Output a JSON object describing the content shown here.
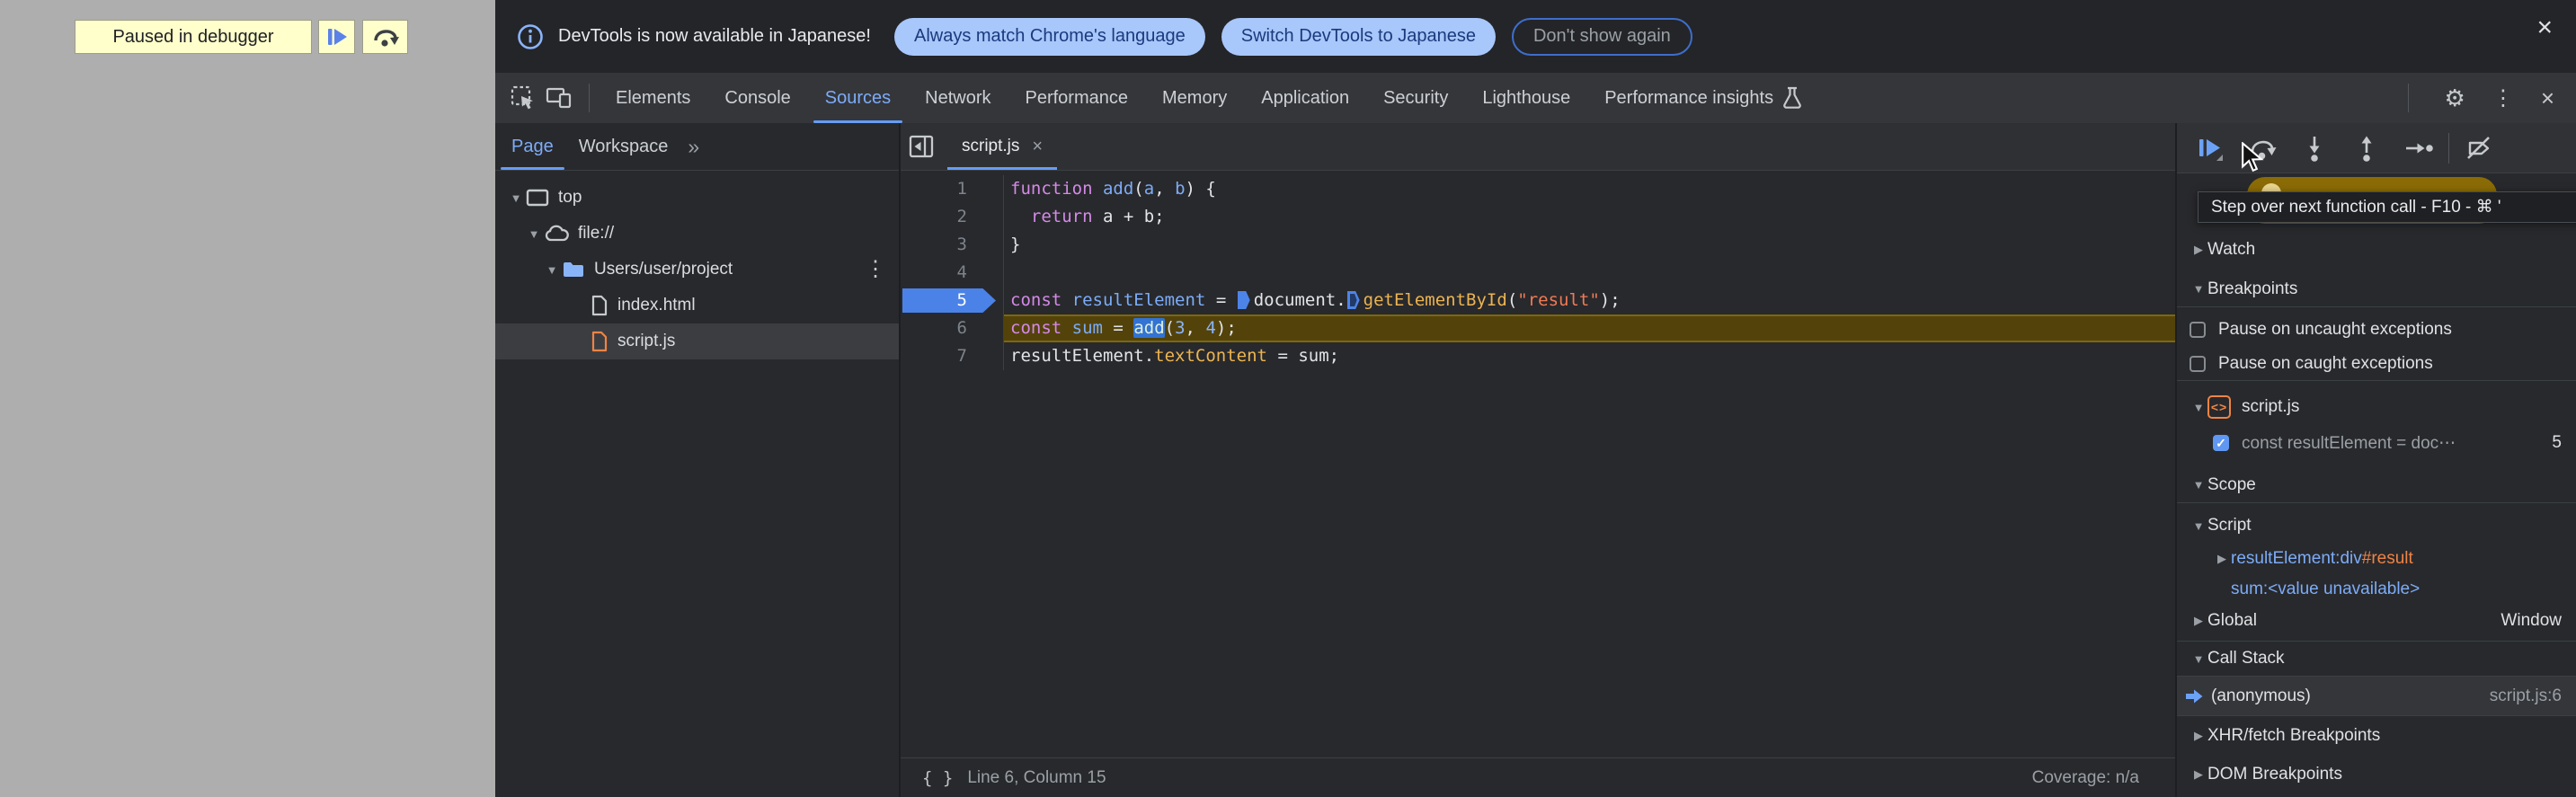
{
  "palette": {
    "accent_blue": "#7cacf8",
    "breakpoint_blue": "#4a82e8",
    "paused_line_gold": "#53430b",
    "string_orange": "#f07a56",
    "keyword_purple": "#d48ae8",
    "property_yellow": "#ecb452",
    "warning_yellow": "#ffffcc",
    "panel_dark": "#28292c"
  },
  "page": {
    "paused_banner": {
      "label": "Paused in debugger"
    }
  },
  "banner": {
    "message": "DevTools is now available in Japanese!",
    "primary_button": "Always match Chrome's language",
    "secondary_button": "Switch DevTools to Japanese",
    "dismiss_button": "Don't show again",
    "close": "×"
  },
  "tabs": {
    "items": [
      {
        "slug": "elements",
        "label": "Elements",
        "selected": false
      },
      {
        "slug": "console",
        "label": "Console",
        "selected": false
      },
      {
        "slug": "sources",
        "label": "Sources",
        "selected": true
      },
      {
        "slug": "network",
        "label": "Network",
        "selected": false
      },
      {
        "slug": "performance",
        "label": "Performance",
        "selected": false
      },
      {
        "slug": "memory",
        "label": "Memory",
        "selected": false
      },
      {
        "slug": "application",
        "label": "Application",
        "selected": false
      },
      {
        "slug": "security",
        "label": "Security",
        "selected": false
      },
      {
        "slug": "lighthouse",
        "label": "Lighthouse",
        "selected": false
      },
      {
        "slug": "performance-insights",
        "label": "Performance insights",
        "selected": false,
        "icon": "flask"
      }
    ],
    "right_icons": {
      "settings": "⚙",
      "more": "⋮",
      "close": "×"
    }
  },
  "navigator": {
    "page_tab": "Page",
    "workspace_tab": "Workspace",
    "more_tabs": "»",
    "menu": "⋮",
    "tree": [
      {
        "label": "top"
      },
      {
        "label": "file://"
      },
      {
        "label": "Users/user/project"
      },
      {
        "label": "index.html"
      },
      {
        "label": "script.js",
        "selected": true
      }
    ]
  },
  "editor": {
    "file_tab": "script.js",
    "file_tab_close": "×",
    "lines": [
      {
        "num": "1",
        "tokens": [
          {
            "c": "kw",
            "t": "function"
          },
          {
            "c": "pl",
            "t": " "
          },
          {
            "c": "vr",
            "t": "add"
          },
          {
            "c": "pl",
            "t": "("
          },
          {
            "c": "vr",
            "t": "a"
          },
          {
            "c": "pl",
            "t": ", "
          },
          {
            "c": "vr",
            "t": "b"
          },
          {
            "c": "pl",
            "t": ") {"
          }
        ]
      },
      {
        "num": "2",
        "tokens": [
          {
            "c": "pl",
            "t": "  "
          },
          {
            "c": "kw",
            "t": "return"
          },
          {
            "c": "pl",
            "t": " a + b;"
          }
        ]
      },
      {
        "num": "3",
        "tokens": [
          {
            "c": "pl",
            "t": "}"
          }
        ]
      },
      {
        "num": "4",
        "tokens": []
      },
      {
        "num": "5",
        "bp": true,
        "tokens": [
          {
            "c": "kw",
            "t": "const"
          },
          {
            "c": "pl",
            "t": " "
          },
          {
            "c": "vr",
            "t": "resultElement"
          },
          {
            "c": "pl",
            "t": " = "
          },
          {
            "c": "mk"
          },
          {
            "c": "pl",
            "t": "document."
          },
          {
            "c": "mko"
          },
          {
            "c": "fn",
            "t": "getElementById"
          },
          {
            "c": "pl",
            "t": "("
          },
          {
            "c": "str",
            "t": "\"result\""
          },
          {
            "c": "pl",
            "t": ");"
          }
        ]
      },
      {
        "num": "6",
        "paused": true,
        "tokens": [
          {
            "c": "kw",
            "t": "const"
          },
          {
            "c": "pl",
            "t": " "
          },
          {
            "c": "vr",
            "t": "sum"
          },
          {
            "c": "pl",
            "t": " = "
          },
          {
            "c": "sel",
            "t": "add"
          },
          {
            "c": "pl",
            "t": "("
          },
          {
            "c": "num2",
            "t": "3"
          },
          {
            "c": "pl",
            "t": ", "
          },
          {
            "c": "num2",
            "t": "4"
          },
          {
            "c": "pl",
            "t": ");"
          }
        ]
      },
      {
        "num": "7",
        "tokens": [
          {
            "c": "pl",
            "t": "resultElement."
          },
          {
            "c": "fn",
            "t": "textContent"
          },
          {
            "c": "pl",
            "t": " = sum;"
          }
        ]
      }
    ],
    "status": {
      "braces": "{ }",
      "position": "Line 6, Column 15",
      "coverage": "Coverage: n/a"
    }
  },
  "debugger": {
    "tooltip": "Step over next function call - F10 - ⌘ '",
    "watch": "Watch",
    "breakpoints": "Breakpoints",
    "pause_uncaught": "Pause on uncaught exceptions",
    "pause_caught": "Pause on caught exceptions",
    "bp_group": {
      "file": "script.js",
      "entry_text": "const resultElement = doc⋯",
      "entry_line": "5",
      "check": "✓"
    },
    "scope": "Scope",
    "scope_script": "Script",
    "var_result": {
      "name": "resultElement",
      "sep": ": ",
      "tag": "div",
      "id": "#result"
    },
    "var_sum": {
      "name": "sum",
      "sep": ": ",
      "value": "<value unavailable>"
    },
    "global": {
      "label": "Global",
      "value": "Window"
    },
    "call_stack": "Call Stack",
    "frame": {
      "name": "(anonymous)",
      "location": "script.js:6"
    },
    "xhr": "XHR/fetch Breakpoints",
    "dom": "DOM Breakpoints"
  }
}
